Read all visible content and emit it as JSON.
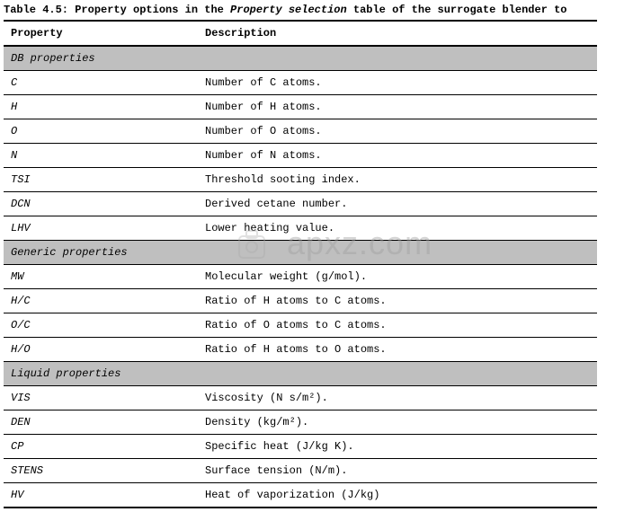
{
  "caption": {
    "prefix": "Table 4.5: Property options in the ",
    "em": "Property selection",
    "suffix": " table of the surrogate blender to"
  },
  "headers": {
    "property": "Property",
    "description": "Description"
  },
  "sections": [
    {
      "title": "DB properties",
      "rows": [
        {
          "prop": "C",
          "desc": "Number of C atoms."
        },
        {
          "prop": "H",
          "desc": "Number of H atoms."
        },
        {
          "prop": "O",
          "desc": "Number of O atoms."
        },
        {
          "prop": "N",
          "desc": "Number of N atoms."
        },
        {
          "prop": "TSI",
          "desc": "Threshold sooting index."
        },
        {
          "prop": "DCN",
          "desc": "Derived cetane number."
        },
        {
          "prop": "LHV",
          "desc": "Lower heating value."
        }
      ]
    },
    {
      "title": "Generic properties",
      "rows": [
        {
          "prop": "MW",
          "desc": "Molecular weight (g/mol)."
        },
        {
          "prop": "H/C",
          "desc": "Ratio of H atoms to C atoms."
        },
        {
          "prop": "O/C",
          "desc": "Ratio of O atoms to C atoms."
        },
        {
          "prop": "H/O",
          "desc": "Ratio of H atoms to O atoms."
        }
      ]
    },
    {
      "title": "Liquid properties",
      "rows": [
        {
          "prop": "VIS",
          "desc": "Viscosity (N s/m²)."
        },
        {
          "prop": "DEN",
          "desc": "Density (kg/m²)."
        },
        {
          "prop": "CP",
          "desc": "Specific heat (J/kg K)."
        },
        {
          "prop": "STENS",
          "desc": "Surface tension (N/m)."
        },
        {
          "prop": "HV",
          "desc": "Heat of vaporization (J/kg)"
        }
      ]
    }
  ],
  "watermark": {
    "text": "apxz.com"
  }
}
